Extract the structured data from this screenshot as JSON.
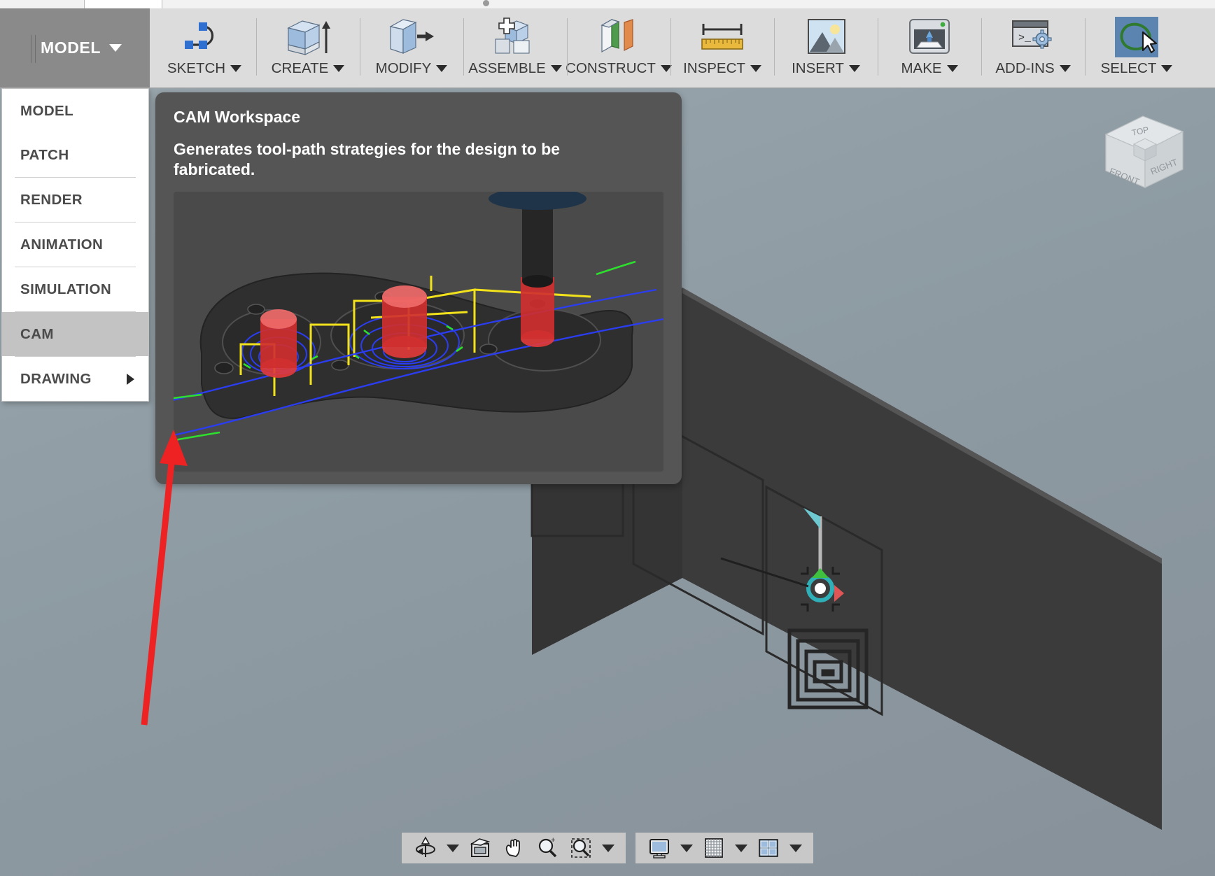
{
  "app": {
    "workspace_switcher": {
      "label": "MODEL",
      "caret_icon": "chevron-down-icon"
    }
  },
  "ribbon": {
    "panels": [
      {
        "label": "SKETCH",
        "icon": "spline-curve-icon",
        "selected": false
      },
      {
        "label": "CREATE",
        "icon": "extrude-box-icon",
        "selected": false
      },
      {
        "label": "MODIFY",
        "icon": "press-pull-box-icon",
        "selected": false
      },
      {
        "label": "ASSEMBLE",
        "icon": "new-component-icon",
        "selected": false
      },
      {
        "label": "CONSTRUCT",
        "icon": "construct-plane-icon",
        "selected": false
      },
      {
        "label": "INSPECT",
        "icon": "ruler-measure-icon",
        "selected": false
      },
      {
        "label": "INSERT",
        "icon": "insert-image-icon",
        "selected": false
      },
      {
        "label": "MAKE",
        "icon": "3d-print-icon",
        "selected": false
      },
      {
        "label": "ADD-INS",
        "icon": "script-gear-icon",
        "selected": false
      },
      {
        "label": "SELECT",
        "icon": "lasso-select-icon",
        "selected": true
      }
    ]
  },
  "workspace_menu": {
    "items": [
      {
        "label": "MODEL",
        "active": false,
        "has_submenu": false,
        "divider_above": false
      },
      {
        "label": "PATCH",
        "active": false,
        "has_submenu": false,
        "divider_above": false
      },
      {
        "label": "RENDER",
        "active": false,
        "has_submenu": false,
        "divider_above": true
      },
      {
        "label": "ANIMATION",
        "active": false,
        "has_submenu": false,
        "divider_above": true
      },
      {
        "label": "SIMULATION",
        "active": false,
        "has_submenu": false,
        "divider_above": true
      },
      {
        "label": "CAM",
        "active": true,
        "has_submenu": false,
        "divider_above": true
      },
      {
        "label": "DRAWING",
        "active": false,
        "has_submenu": true,
        "divider_above": true
      }
    ]
  },
  "tooltip": {
    "title": "CAM Workspace",
    "description": "Generates tool-path strategies for the design to be fabricated.",
    "preview_image": "cam-toolpath-preview"
  },
  "viewcube": {
    "faces": {
      "top": "TOP",
      "front": "FRONT",
      "right": "RIGHT"
    }
  },
  "navbar": {
    "groups": [
      {
        "name": "navigation-group",
        "buttons": [
          {
            "icon": "orbit-icon",
            "has_caret": true
          },
          {
            "icon": "look-at-icon",
            "has_caret": false
          },
          {
            "icon": "pan-hand-icon",
            "has_caret": false
          },
          {
            "icon": "zoom-icon",
            "has_caret": false
          },
          {
            "icon": "zoom-window-icon",
            "has_caret": true
          }
        ]
      },
      {
        "name": "display-group",
        "buttons": [
          {
            "icon": "display-settings-icon",
            "has_caret": true
          },
          {
            "icon": "grid-snap-icon",
            "has_caret": true
          },
          {
            "icon": "viewport-layout-icon",
            "has_caret": true
          }
        ]
      }
    ]
  },
  "annotation": {
    "arrow": "red-pointer-arrow",
    "color": "#ee2222",
    "points_to": "CAM"
  },
  "colors": {
    "ribbon_bg": "#dcdcdc",
    "workspace_switch_bg": "#8a8a8a",
    "viewport_bg": "#8d9aa2",
    "menu_active_bg": "#c3c3c3",
    "tooltip_bg": "#555555",
    "select_highlight": "#5b85b0",
    "annotation_red": "#ee2222"
  }
}
